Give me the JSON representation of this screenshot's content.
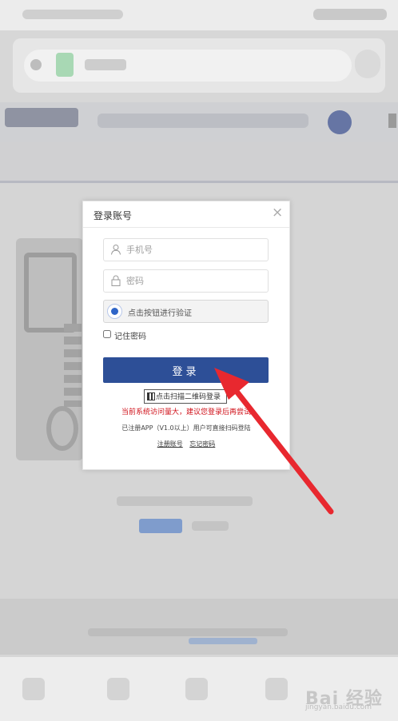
{
  "dialog": {
    "title": "登录账号",
    "close_glyph": "×",
    "phone_placeholder": "手机号",
    "password_placeholder": "密码",
    "verify_label": "点击按钮进行验证",
    "remember_label": "记住密码",
    "login_label": "登录",
    "qr_login_label": "点击扫描二维码登录",
    "warning": "当前系统访问量大，建议您登录后再尝试",
    "app_hint": "已注册APP（V1.0以上）用户可直接扫码登陆",
    "register_link": "注册账号",
    "forgot_link": "忘记密码",
    "accent_color": "#2d4f97",
    "warning_color": "#d0111a"
  },
  "annotation": {
    "arrow_color": "#e8282f"
  },
  "watermark": {
    "text": "Bai 经验",
    "sub": "jingyan.baidu.com"
  }
}
